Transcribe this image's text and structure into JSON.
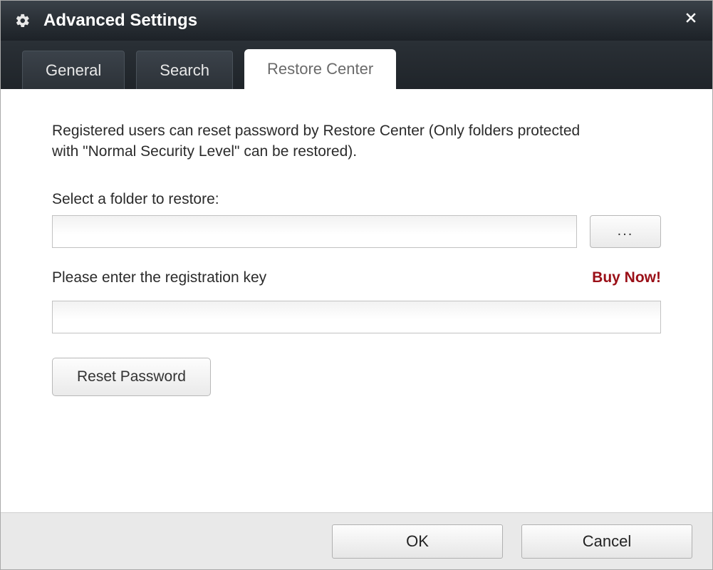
{
  "window": {
    "title": "Advanced Settings"
  },
  "tabs": {
    "general": "General",
    "search": "Search",
    "restore": "Restore Center"
  },
  "content": {
    "description": "Registered users can reset password by Restore Center (Only folders protected with \"Normal Security Level\" can be restored).",
    "folder_label": "Select a folder to restore:",
    "folder_value": "",
    "browse_label": "...",
    "reg_label": "Please enter the registration key",
    "buy_label": "Buy Now!",
    "reg_value": "",
    "reset_label": "Reset Password"
  },
  "footer": {
    "ok": "OK",
    "cancel": "Cancel"
  }
}
